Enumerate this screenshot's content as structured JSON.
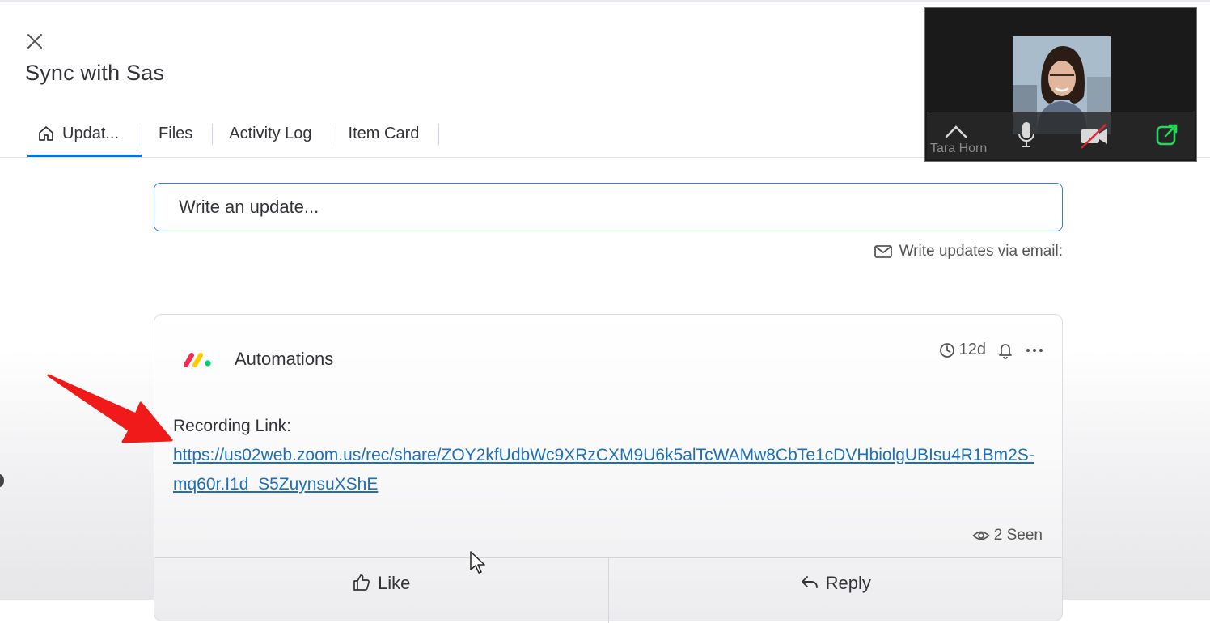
{
  "item": {
    "title": "Sync with Sas"
  },
  "tabs": [
    {
      "label": "Updat...",
      "active": true
    },
    {
      "label": "Files",
      "active": false
    },
    {
      "label": "Activity Log",
      "active": false
    },
    {
      "label": "Item Card",
      "active": false
    }
  ],
  "composer": {
    "placeholder": "Write an update...",
    "email_label": "Write updates via email:"
  },
  "update": {
    "author": "Automations",
    "age": "12d",
    "body_label": "Recording Link:",
    "link": "https://us02web.zoom.us/rec/share/ZOY2kfUdbWc9XRzCXM9U6k5alTcWAMw8CbTe1cDVHbiolgUBIsu4R1Bm2S-mq60r.I1d_S5ZuynsuXShE",
    "seen": "2 Seen",
    "like_label": "Like",
    "reply_label": "Reply"
  },
  "video_call": {
    "participant_name": "Tara Horn",
    "mic_state": "on",
    "camera_state": "off"
  },
  "colors": {
    "accent": "#0073ea",
    "link": "#1f6fb8",
    "arrow": "#f01a1a",
    "logo_red": "#f62b54",
    "logo_yellow": "#ffcc00",
    "logo_green": "#00ca72",
    "share_green": "#23d959"
  },
  "icons": [
    "close-icon",
    "home-icon",
    "mail-icon",
    "monday-logo-icon",
    "clock-icon",
    "bell-icon",
    "more-icon",
    "eye-icon",
    "thumbs-up-icon",
    "reply-icon",
    "chevron-up-icon",
    "microphone-icon",
    "video-off-icon",
    "share-screen-icon",
    "arrow-annotation-icon",
    "mouse-cursor-icon"
  ]
}
